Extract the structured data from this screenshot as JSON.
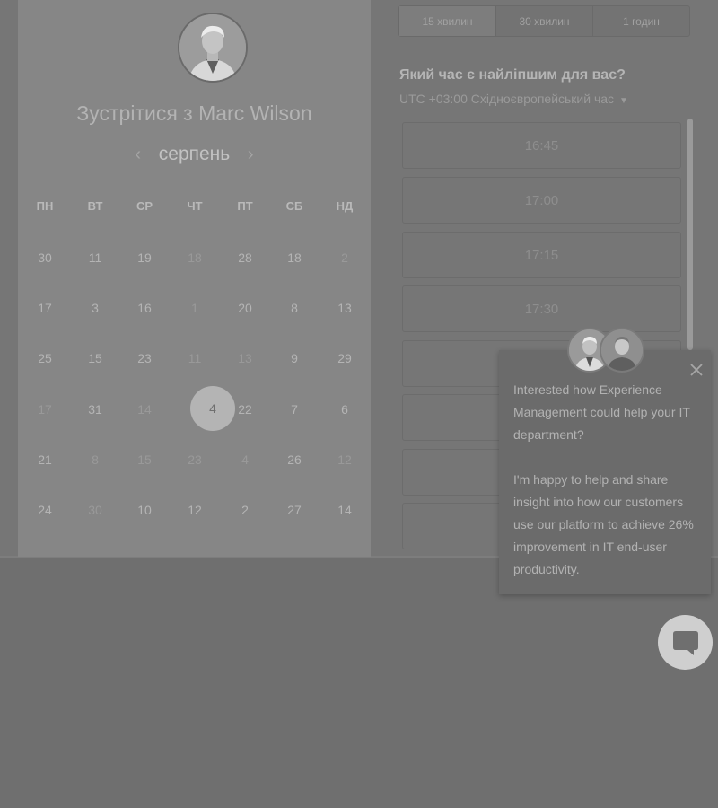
{
  "calendar": {
    "title": "Зустрітися з Marc Wilson",
    "month": "серпень",
    "prev_icon": "chevron-left-icon",
    "next_icon": "chevron-right-icon",
    "weekdays": [
      "ПН",
      "ВТ",
      "СР",
      "ЧТ",
      "ПТ",
      "СБ",
      "НД"
    ],
    "weeks": [
      [
        "30",
        "11",
        "19",
        "18",
        "28",
        "18",
        "2"
      ],
      [
        "17",
        "3",
        "16",
        "1",
        "20",
        "8",
        "13"
      ],
      [
        "25",
        "15",
        "23",
        "11",
        "13",
        "9",
        "29"
      ],
      [
        "17",
        "31",
        "14",
        "4",
        "22",
        "7",
        "6"
      ],
      [
        "21",
        "8",
        "15",
        "23",
        "4",
        "26",
        "12"
      ],
      [
        "24",
        "30",
        "10",
        "12",
        "2",
        "27",
        "14"
      ]
    ],
    "selected_day": "4"
  },
  "durations": {
    "tabs": [
      "15 хвилин",
      "30 хвилин",
      "1 годин"
    ],
    "active_index": 0
  },
  "times": {
    "question": "Який час є найліпшим для вас?",
    "timezone": "UTC +03:00 Східноєвропейський час",
    "slots": [
      "16:45",
      "17:00",
      "17:15",
      "17:30"
    ]
  },
  "chat": {
    "message": "Interested how Experience Management could help your IT department?\n\nI'm happy to help and share insight into how our customers use our platform to achieve 26% improvement in IT end-user productivity.",
    "close_icon": "close-icon",
    "button_icon": "chat-bubble-icon"
  },
  "colors": {
    "overlay": "#6f6f6f",
    "panel": "#868686",
    "chat_button": "#cfcfcf"
  }
}
